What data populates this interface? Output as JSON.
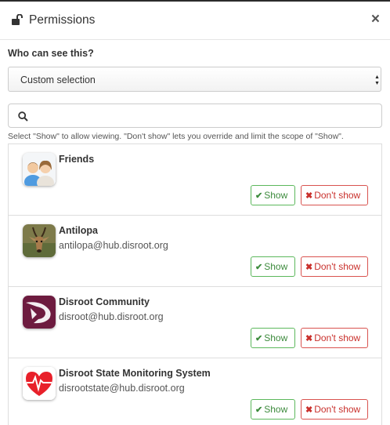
{
  "dialog": {
    "title": "Permissions",
    "close_glyph": "×",
    "lock_icon": "lock-open-icon"
  },
  "audience": {
    "label": "Who can see this?",
    "selected": "Custom selection"
  },
  "search": {
    "placeholder": "",
    "icon": "search-icon"
  },
  "help_text": "Select \"Show\" to allow viewing. \"Don't show\" lets you override and limit the scope of \"Show\".",
  "buttons": {
    "show_glyph": "✔",
    "show_label": "Show",
    "dont_glyph": "✖",
    "dont_label": "Don't show"
  },
  "items": [
    {
      "name": "Friends",
      "email": "",
      "avatar": "friends-group-avatar"
    },
    {
      "name": "Antilopa",
      "email": "antilopa@hub.disroot.org",
      "avatar": "antelope-avatar"
    },
    {
      "name": "Disroot Community",
      "email": "disroot@hub.disroot.org",
      "avatar": "disroot-logo-avatar"
    },
    {
      "name": "Disroot State Monitoring System",
      "email": "disrootstate@hub.disroot.org",
      "avatar": "heart-monitor-avatar"
    }
  ],
  "colors": {
    "show_border": "#5cb85c",
    "dont_border": "#d9534f",
    "disroot_purple": "#6d1b3f",
    "heart_red": "#e8202a"
  }
}
